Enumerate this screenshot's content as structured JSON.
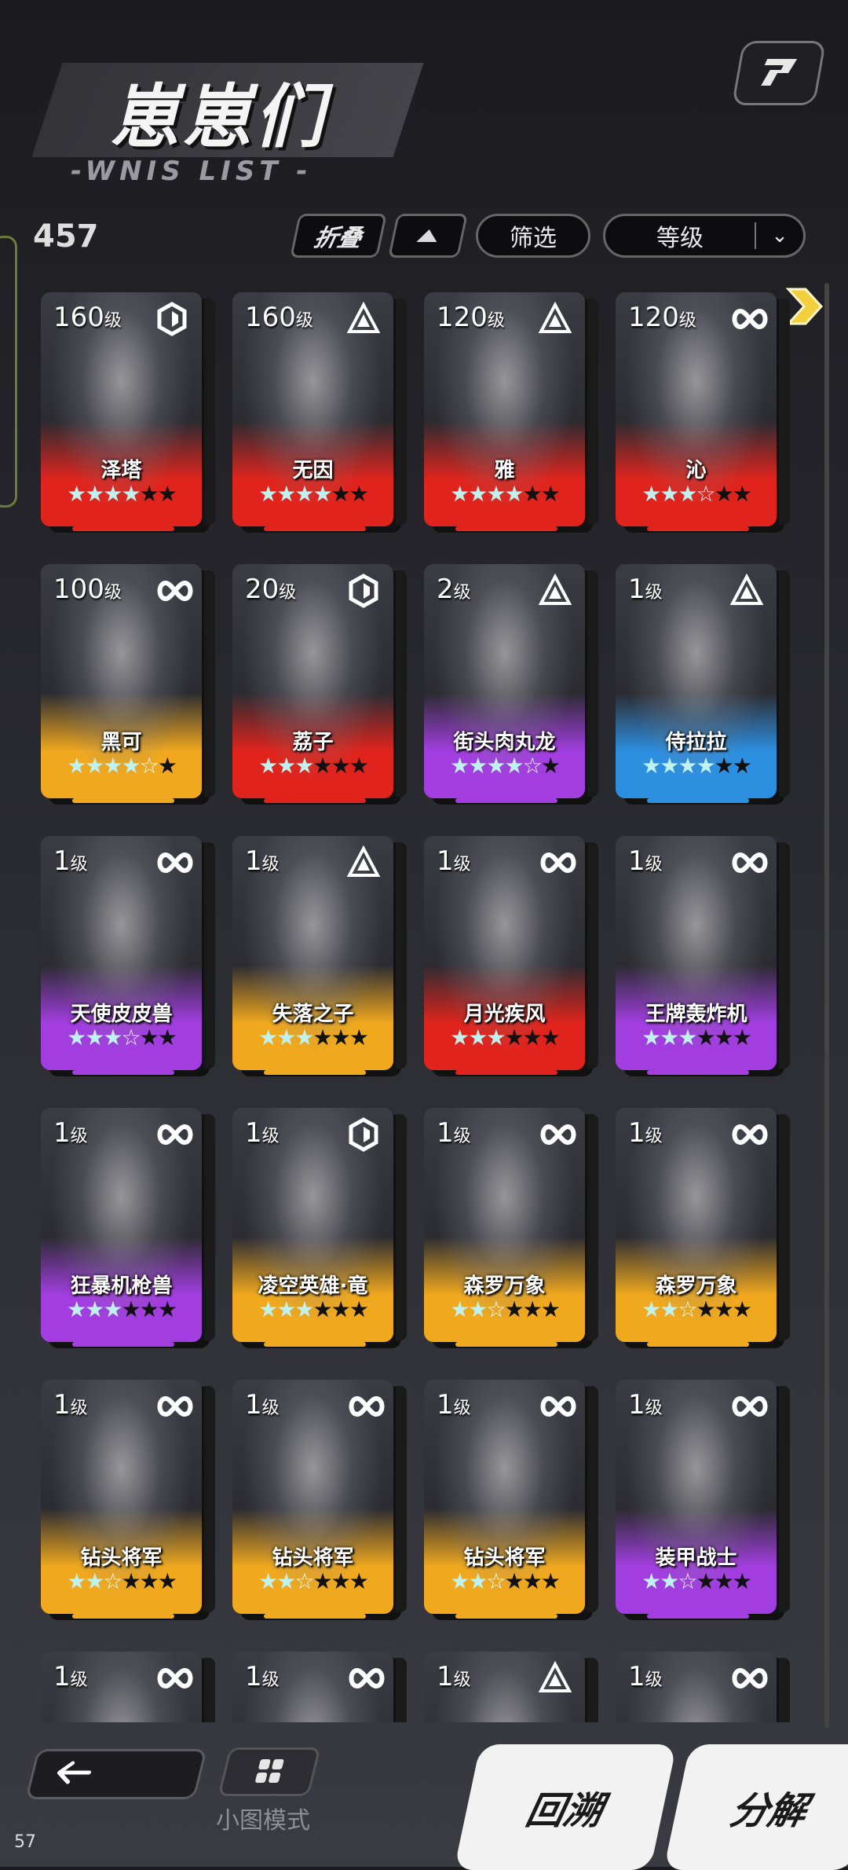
{
  "header": {
    "title": "崽崽们",
    "subtitle": "-WNIS LIST -"
  },
  "toolbar": {
    "count": "457",
    "fold_label": "折叠",
    "filter_label": "筛选",
    "sort_label": "等级"
  },
  "cards": [
    {
      "level": "160",
      "level_unit": "级",
      "attr": "hex-icon",
      "name": "泽塔",
      "stars_on": 4,
      "stars_half": 0,
      "stars_total": 6,
      "rarity_color": "#e0241d"
    },
    {
      "level": "160",
      "level_unit": "级",
      "attr": "triangle-icon",
      "name": "无因",
      "stars_on": 4,
      "stars_half": 0,
      "stars_total": 6,
      "rarity_color": "#e0241d"
    },
    {
      "level": "120",
      "level_unit": "级",
      "attr": "triangle-icon",
      "name": "雅",
      "stars_on": 4,
      "stars_half": 0,
      "stars_total": 6,
      "rarity_color": "#e0241d"
    },
    {
      "level": "120",
      "level_unit": "级",
      "attr": "infinity-icon",
      "name": "沁",
      "stars_on": 3,
      "stars_half": 1,
      "stars_total": 6,
      "rarity_color": "#e0241d"
    },
    {
      "level": "100",
      "level_unit": "级",
      "attr": "infinity-icon",
      "name": "黑可",
      "stars_on": 4,
      "stars_half": 1,
      "stars_total": 6,
      "rarity_color": "#f0a91e"
    },
    {
      "level": "20",
      "level_unit": "级",
      "attr": "hex-icon",
      "name": "荔子",
      "stars_on": 3,
      "stars_half": 0,
      "stars_total": 6,
      "rarity_color": "#e0241d"
    },
    {
      "level": "2",
      "level_unit": "级",
      "attr": "triangle-icon",
      "name": "街头肉丸龙",
      "stars_on": 4,
      "stars_half": 1,
      "stars_total": 6,
      "rarity_color": "#a23ee0"
    },
    {
      "level": "1",
      "level_unit": "级",
      "attr": "triangle-icon",
      "name": "侍拉拉",
      "stars_on": 4,
      "stars_half": 0,
      "stars_total": 6,
      "rarity_color": "#2d8fe0"
    },
    {
      "level": "1",
      "level_unit": "级",
      "attr": "infinity-icon",
      "name": "天使皮皮兽",
      "stars_on": 3,
      "stars_half": 1,
      "stars_total": 6,
      "rarity_color": "#a23ee0"
    },
    {
      "level": "1",
      "level_unit": "级",
      "attr": "triangle-icon",
      "name": "失落之子",
      "stars_on": 3,
      "stars_half": 0,
      "stars_total": 6,
      "rarity_color": "#f0a91e"
    },
    {
      "level": "1",
      "level_unit": "级",
      "attr": "infinity-icon",
      "name": "月光疾风",
      "stars_on": 3,
      "stars_half": 0,
      "stars_total": 6,
      "rarity_color": "#e0241d"
    },
    {
      "level": "1",
      "level_unit": "级",
      "attr": "infinity-icon",
      "name": "王牌轰炸机",
      "stars_on": 3,
      "stars_half": 0,
      "stars_total": 6,
      "rarity_color": "#a23ee0"
    },
    {
      "level": "1",
      "level_unit": "级",
      "attr": "infinity-icon",
      "name": "狂暴机枪兽",
      "stars_on": 3,
      "stars_half": 0,
      "stars_total": 6,
      "rarity_color": "#a23ee0"
    },
    {
      "level": "1",
      "level_unit": "级",
      "attr": "hex-icon",
      "name": "凌空英雄·竜",
      "stars_on": 3,
      "stars_half": 0,
      "stars_total": 6,
      "rarity_color": "#f0a91e"
    },
    {
      "level": "1",
      "level_unit": "级",
      "attr": "infinity-icon",
      "name": "森罗万象",
      "stars_on": 2,
      "stars_half": 1,
      "stars_total": 6,
      "rarity_color": "#f0a91e"
    },
    {
      "level": "1",
      "level_unit": "级",
      "attr": "infinity-icon",
      "name": "森罗万象",
      "stars_on": 2,
      "stars_half": 1,
      "stars_total": 6,
      "rarity_color": "#f0a91e"
    },
    {
      "level": "1",
      "level_unit": "级",
      "attr": "infinity-icon",
      "name": "钻头将军",
      "stars_on": 2,
      "stars_half": 1,
      "stars_total": 6,
      "rarity_color": "#f0a91e"
    },
    {
      "level": "1",
      "level_unit": "级",
      "attr": "infinity-icon",
      "name": "钻头将军",
      "stars_on": 2,
      "stars_half": 1,
      "stars_total": 6,
      "rarity_color": "#f0a91e"
    },
    {
      "level": "1",
      "level_unit": "级",
      "attr": "infinity-icon",
      "name": "钻头将军",
      "stars_on": 2,
      "stars_half": 1,
      "stars_total": 6,
      "rarity_color": "#f0a91e"
    },
    {
      "level": "1",
      "level_unit": "级",
      "attr": "infinity-icon",
      "name": "装甲战士",
      "stars_on": 2,
      "stars_half": 1,
      "stars_total": 6,
      "rarity_color": "#a23ee0"
    },
    {
      "level": "1",
      "level_unit": "级",
      "attr": "infinity-icon",
      "name": "",
      "stars_on": 0,
      "stars_half": 0,
      "stars_total": 0,
      "rarity_color": "#e0241d"
    },
    {
      "level": "1",
      "level_unit": "级",
      "attr": "infinity-icon",
      "name": "",
      "stars_on": 0,
      "stars_half": 0,
      "stars_total": 0,
      "rarity_color": "#e0241d"
    },
    {
      "level": "1",
      "level_unit": "级",
      "attr": "triangle-icon",
      "name": "",
      "stars_on": 0,
      "stars_half": 0,
      "stars_total": 0,
      "rarity_color": "#2a8a4a"
    },
    {
      "level": "1",
      "level_unit": "级",
      "attr": "infinity-icon",
      "name": "",
      "stars_on": 0,
      "stars_half": 0,
      "stars_total": 0,
      "rarity_color": "#a23ee0"
    }
  ],
  "footer": {
    "mini_mode_label": "小图模式",
    "rewind_label": "回溯",
    "decompose_label": "分解",
    "fps": "57"
  }
}
